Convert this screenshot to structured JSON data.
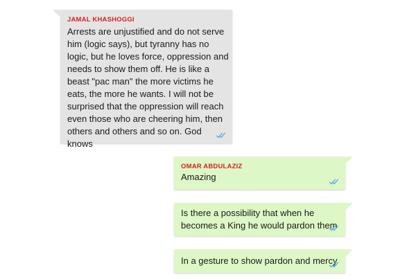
{
  "messages": [
    {
      "direction": "incoming",
      "sender": "JAMAL KHASHOGGI",
      "text": "Arrests are unjustified and do not serve him (logic says), but tyranny has no logic, but he loves force, oppression and needs to show them off. He is like a beast \"pac man\" the more victims he eats, the more he wants. I will not be surprised that the oppression will reach even those who are cheering him, then others and others and so on. God knows",
      "status_icon": "double-check-icon"
    },
    {
      "direction": "outgoing",
      "sender": "OMAR ABDULAZIZ",
      "text": "Amazing",
      "status_icon": "double-check-icon"
    },
    {
      "direction": "outgoing",
      "sender": "",
      "text": "Is there a possibility that when he becomes a King he would pardon them",
      "status_icon": "double-check-icon"
    },
    {
      "direction": "outgoing",
      "sender": "",
      "text": "In a gesture to show pardon and mercy",
      "status_icon": "double-check-icon"
    }
  ],
  "colors": {
    "incoming_bubble": "#e4e4e4",
    "outgoing_bubble": "#ddf7c6",
    "sender_name": "#d62323",
    "read_ticks": "#4fa3e6",
    "message_text": "#1a1a1a"
  }
}
